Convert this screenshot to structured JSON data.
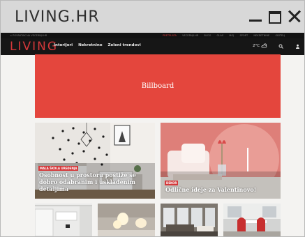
{
  "window": {
    "title": "LIVING.HR"
  },
  "topbar": {
    "back_link": "< POVRATAK NA VECERNJI.HR",
    "links": [
      "PRETPLATA",
      "VECERNJI.HR",
      "BLOG",
      "GLAS",
      "MOJ",
      "SPORT",
      "NEKRETNINE",
      "OBITELJ"
    ]
  },
  "nav": {
    "logo": "LIVING",
    "items": [
      "Interijeri",
      "Nekretnine",
      "Zeleni trendovi"
    ],
    "weather": "2°C",
    "icons": [
      "cloud-sun-icon",
      "search-icon",
      "user-icon"
    ]
  },
  "billboard": {
    "label": "Billboard"
  },
  "featured": [
    {
      "tag": "MALA ŠKOLA UREĐENJA",
      "headline": "Osobnost u prostoru postiže se dobro odabranim i usklađenim detaljima"
    },
    {
      "tag": "DEKOR",
      "headline": "Odlične ideje za Valentinovo!"
    }
  ],
  "colors": {
    "accent": "#d4383a",
    "billboard": "#e4463d",
    "navbar": "#161616"
  }
}
